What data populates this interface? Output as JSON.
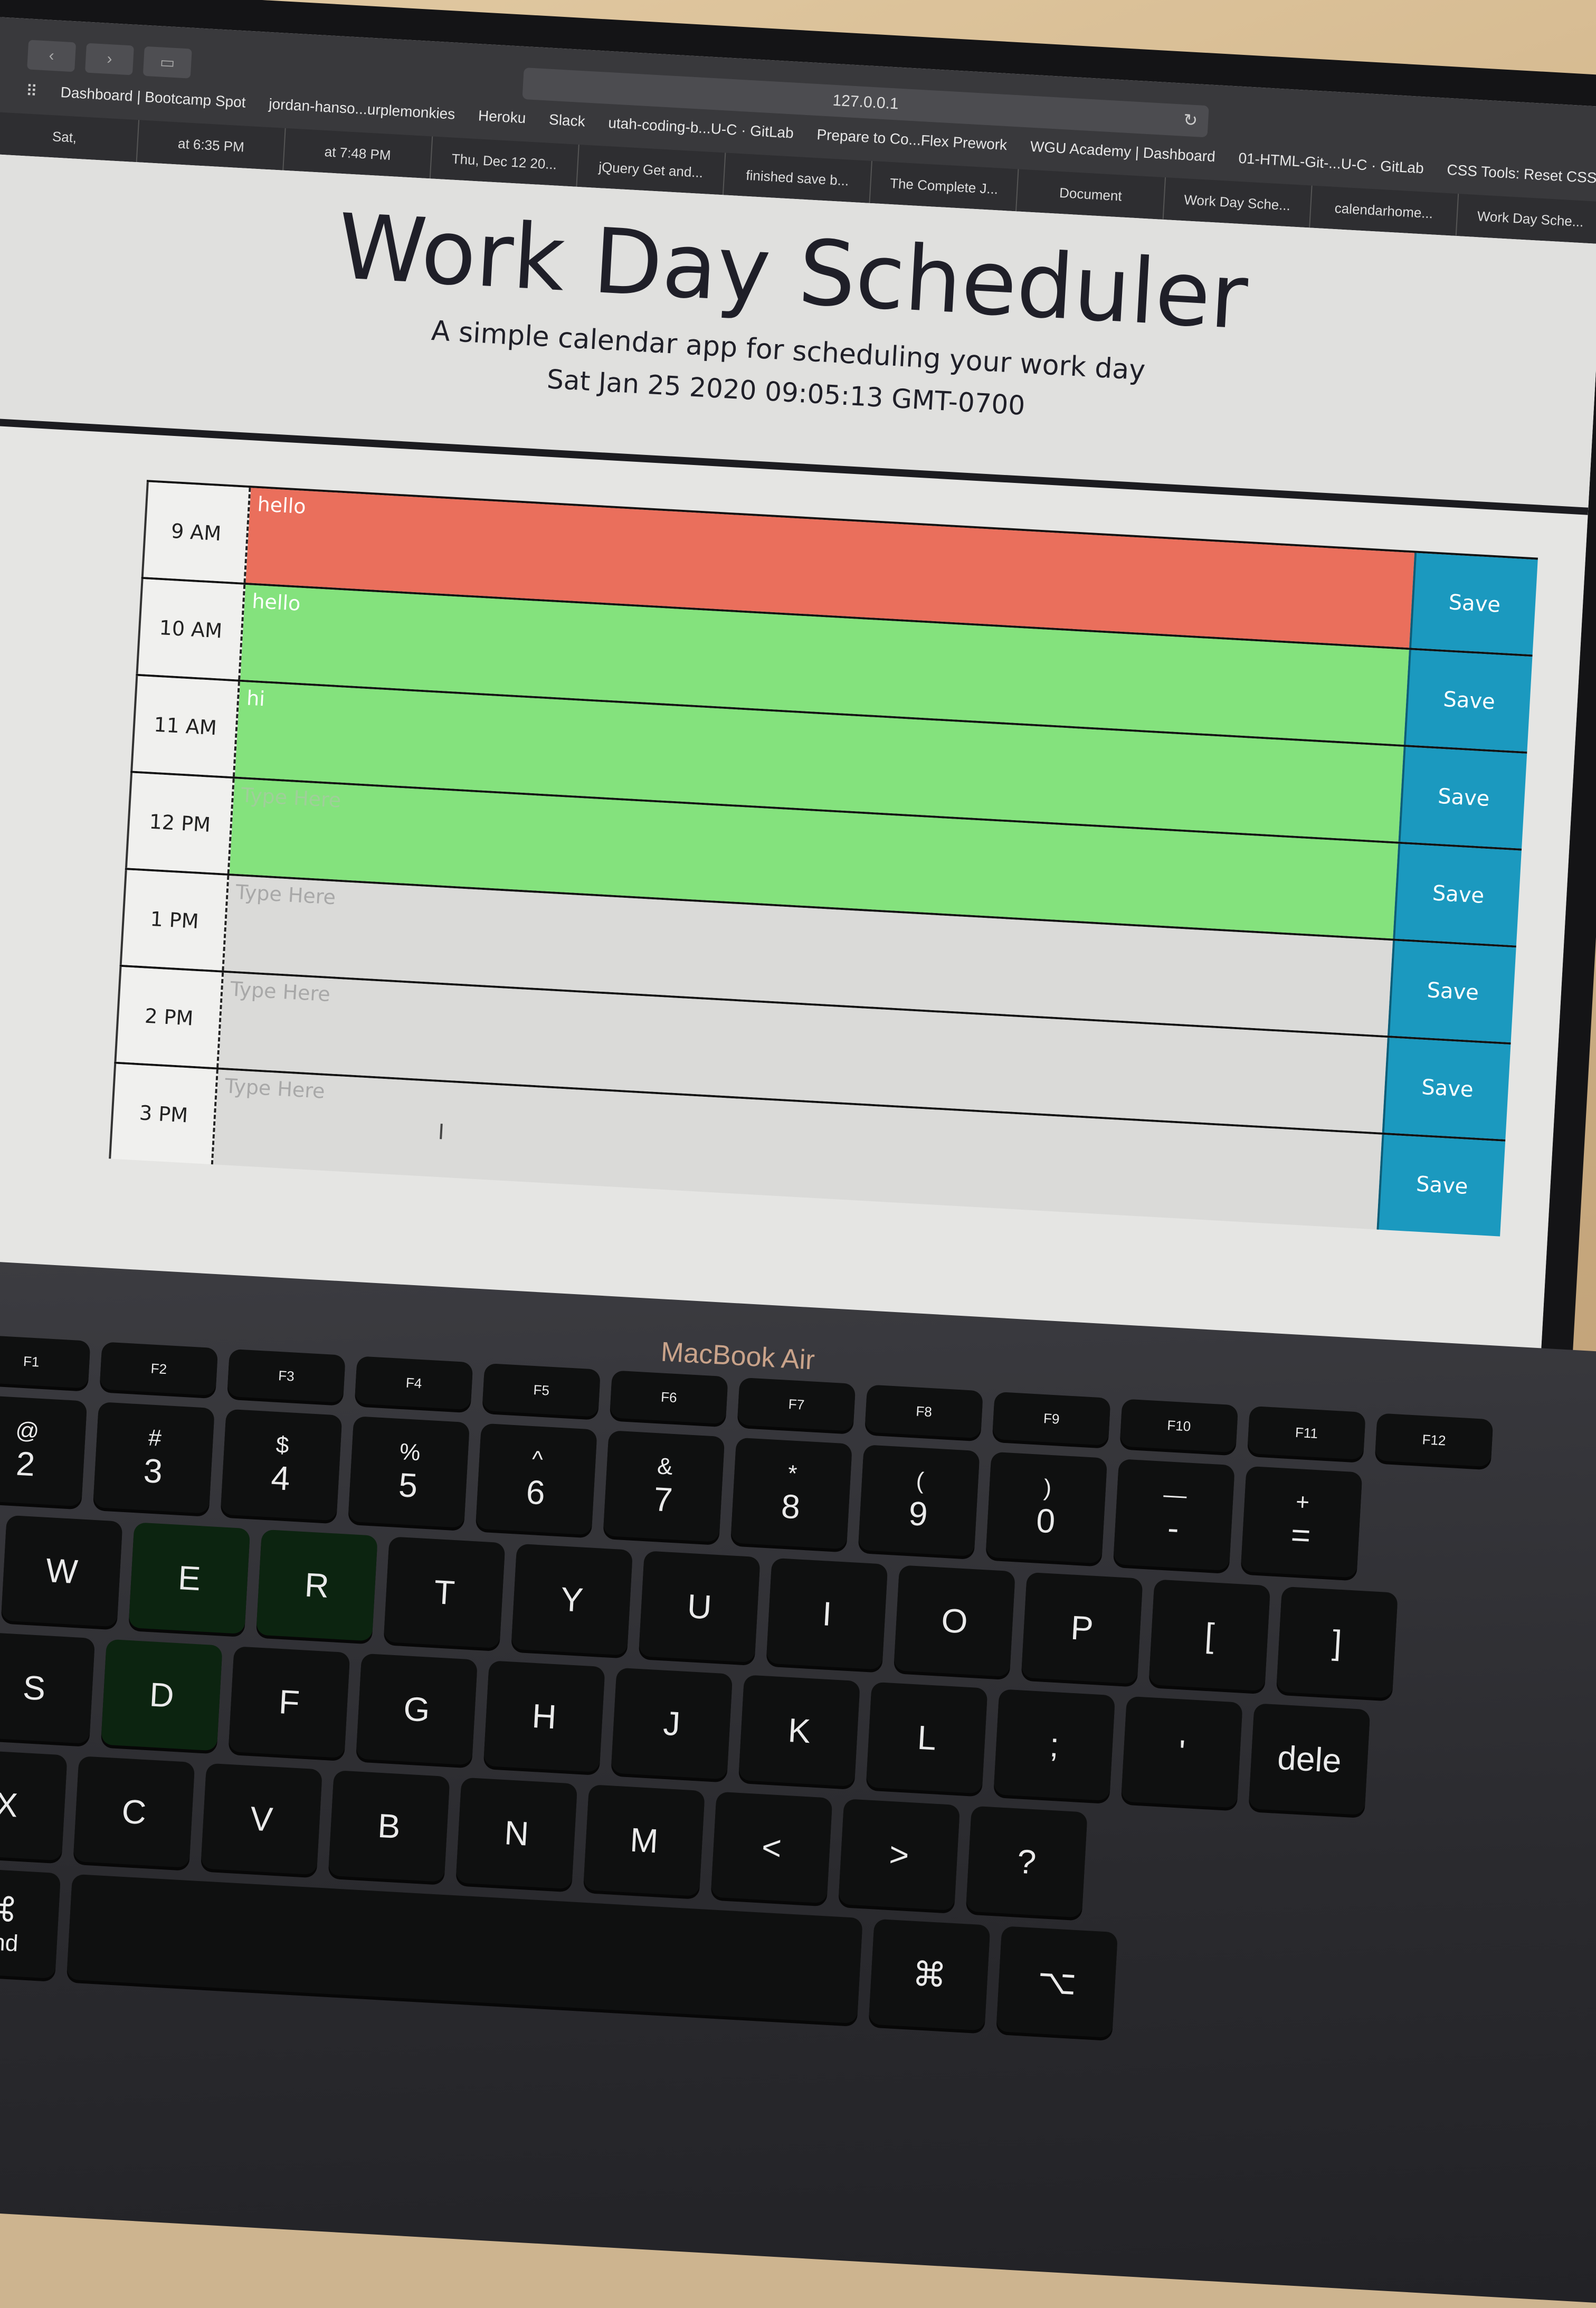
{
  "browser": {
    "address": "127.0.0.1",
    "bookmarks": [
      "Dashboard | Bootcamp Spot",
      "jordan-hanso...urplemonkies",
      "Heroku",
      "Slack",
      "utah-coding-b...U-C · GitLab",
      "Prepare to Co...Flex Prework",
      "WGU Academy | Dashboard",
      "01-HTML-Git-...U-C · GitLab",
      "CSS Tools: Reset CSS"
    ],
    "tabs": [
      "Sat,",
      "at 6:35 PM",
      "at 7:48 PM",
      "Thu, Dec 12 20...",
      "jQuery Get and...",
      "finished save b...",
      "The Complete J...",
      "Document",
      "Work Day Sche...",
      "calendarhome...",
      "Work Day Sche..."
    ]
  },
  "header": {
    "title": "Work Day Scheduler",
    "lead": "A simple calendar app for scheduling your work day",
    "current_day": "Sat Jan 25 2020 09:05:13 GMT-0700"
  },
  "timeblocks": [
    {
      "hour": "9 AM",
      "text": "hello",
      "placeholder": "",
      "state": "present",
      "save": "Save"
    },
    {
      "hour": "10 AM",
      "text": "hello",
      "placeholder": "",
      "state": "future",
      "save": "Save"
    },
    {
      "hour": "11 AM",
      "text": "hi",
      "placeholder": "",
      "state": "future",
      "save": "Save"
    },
    {
      "hour": "12 PM",
      "text": "",
      "placeholder": "Type Here",
      "state": "future",
      "save": "Save"
    },
    {
      "hour": "1 PM",
      "text": "",
      "placeholder": "Type Here",
      "state": "empty",
      "save": "Save"
    },
    {
      "hour": "2 PM",
      "text": "",
      "placeholder": "Type Here",
      "state": "empty",
      "save": "Save"
    },
    {
      "hour": "3 PM",
      "text": "",
      "placeholder": "Type Here",
      "state": "empty",
      "save": "Save"
    }
  ],
  "laptop": {
    "brand": "MacBook Air"
  },
  "keyboard": {
    "fn_row": [
      "F1",
      "F2",
      "F3",
      "F4",
      "F5",
      "F6",
      "F7",
      "F8",
      "F9",
      "F10",
      "F11",
      "F12"
    ],
    "number_row": [
      {
        "top": "@",
        "main": "2"
      },
      {
        "top": "#",
        "main": "3"
      },
      {
        "top": "$",
        "main": "4"
      },
      {
        "top": "%",
        "main": "5"
      },
      {
        "top": "^",
        "main": "6"
      },
      {
        "top": "&",
        "main": "7"
      },
      {
        "top": "*",
        "main": "8"
      },
      {
        "top": "(",
        "main": "9"
      },
      {
        "top": ")",
        "main": "0"
      },
      {
        "top": "—",
        "main": "-"
      },
      {
        "top": "+",
        "main": "="
      }
    ],
    "qwerty_row": [
      "W",
      "E",
      "R",
      "T",
      "Y",
      "U",
      "I",
      "O",
      "P",
      "[",
      "]"
    ],
    "home_row": [
      "S",
      "D",
      "F",
      "G",
      "H",
      "J",
      "K",
      "L",
      ";",
      "'"
    ],
    "bottom_row": [
      "X",
      "C",
      "V",
      "B",
      "N",
      "M",
      "<",
      ">",
      "?"
    ],
    "modifier_left": "⌘",
    "modifier_right": "⌘",
    "option_key": "⌥",
    "delete_label": "dele",
    "command_label": "and"
  },
  "colors": {
    "past": "#ea6f5c",
    "future": "#84e27d",
    "save_button": "#1b99bf"
  }
}
